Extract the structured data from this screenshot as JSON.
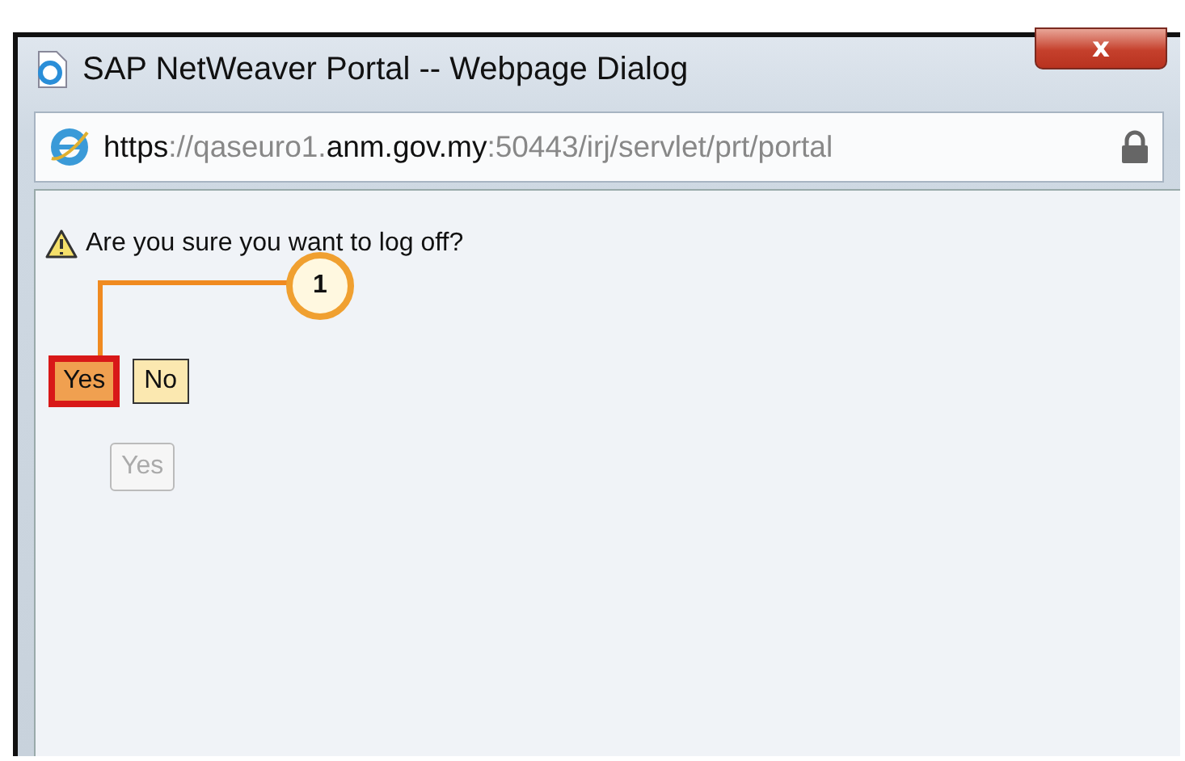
{
  "window": {
    "title": "SAP NetWeaver Portal -- Webpage Dialog",
    "close_label": "x"
  },
  "address_bar": {
    "url_parts": [
      {
        "text": "https",
        "emphasis": true
      },
      {
        "text": "://qaseuro1.",
        "emphasis": false
      },
      {
        "text": "anm.gov.my",
        "emphasis": true
      },
      {
        "text": ":50443/irj/servlet/prt/portal",
        "emphasis": false
      }
    ]
  },
  "message": {
    "text": "Are you sure you want to log off?"
  },
  "buttons": [
    {
      "label": "Yes",
      "highlighted": true,
      "disabled": false
    },
    {
      "label": "No",
      "highlighted": false,
      "disabled": false
    }
  ],
  "secondary_button": {
    "label": "Yes",
    "disabled": true
  },
  "callout": {
    "number": "1"
  }
}
